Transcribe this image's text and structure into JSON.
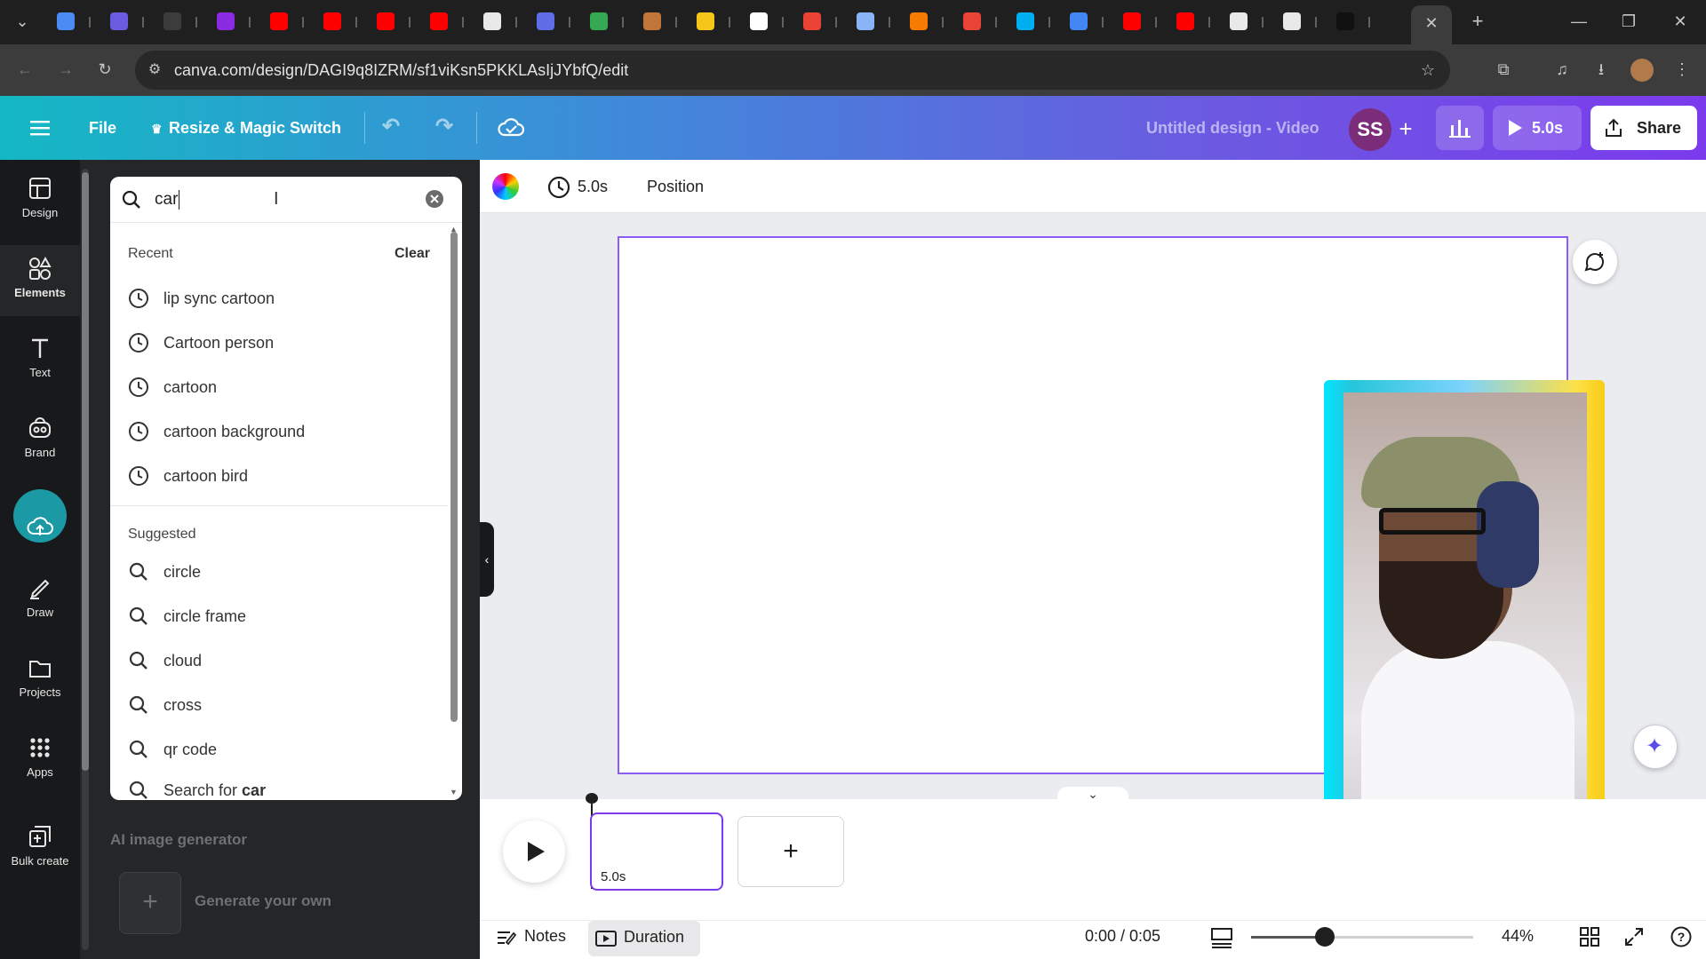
{
  "browser": {
    "url": "canva.com/design/DAGI9q8IZRM/sf1viKsn5PKKLAsIjJYbfQ/edit",
    "tab_icons": [
      "gemini-icon",
      "shield-icon",
      "fast-icon",
      "globe-icon",
      "youtube-icon",
      "youtube-icon",
      "youtube-icon",
      "youtube-icon",
      "chatgpt-icon",
      "meet-icon",
      "download-icon",
      "doc-icon",
      "lemon-icon",
      "wm-icon",
      "gmail-icon",
      "trend-icon",
      "warning-icon",
      "gmail-icon",
      "skype-icon",
      "docs-icon",
      "youtube-icon",
      "youtube-icon",
      "chatgpt-icon",
      "chatgpt-icon",
      "tiktok-icon",
      "canva-icon"
    ]
  },
  "header": {
    "menu_icon": "hamburger-icon",
    "file_label": "File",
    "resize_label": "Resize & Magic Switch",
    "design_title": "Untitled design - Video",
    "avatar_initials": "SS",
    "play_duration": "5.0s",
    "share_label": "Share"
  },
  "rail": {
    "items": [
      {
        "label": "Design",
        "icon": "layout-icon"
      },
      {
        "label": "Elements",
        "icon": "shapes-icon"
      },
      {
        "label": "Text",
        "icon": "text-icon"
      },
      {
        "label": "Brand",
        "icon": "brand-icon"
      },
      {
        "label": "",
        "icon": "upload-cloud-icon"
      },
      {
        "label": "Draw",
        "icon": "pen-icon"
      },
      {
        "label": "Projects",
        "icon": "folder-icon"
      },
      {
        "label": "Apps",
        "icon": "grid-icon"
      },
      {
        "label": "Bulk create",
        "icon": "bulk-icon"
      }
    ]
  },
  "search": {
    "value": "car",
    "recent_heading": "Recent",
    "clear_label": "Clear",
    "recent": [
      "lip sync cartoon",
      "Cartoon person",
      "cartoon",
      "cartoon background",
      "cartoon bird"
    ],
    "suggested_heading": "Suggested",
    "suggested": [
      "circle",
      "circle frame",
      "cloud",
      "cross",
      "qr code"
    ],
    "search_for_prefix": "Search for ",
    "search_for_term": "car"
  },
  "panel": {
    "ai_heading": "AI image generator",
    "generate_label": "Generate your own"
  },
  "editor": {
    "duration": "5.0s",
    "position_label": "Position"
  },
  "timeline": {
    "clip_duration": "5.0s"
  },
  "footer": {
    "notes_label": "Notes",
    "duration_label": "Duration",
    "time": "0:00 / 0:05",
    "zoom": "44%",
    "zoom_level": 0.44
  },
  "colors": {
    "accent": "#7c3aed",
    "header_start": "#14b8c4",
    "header_end": "#7c3aed"
  }
}
